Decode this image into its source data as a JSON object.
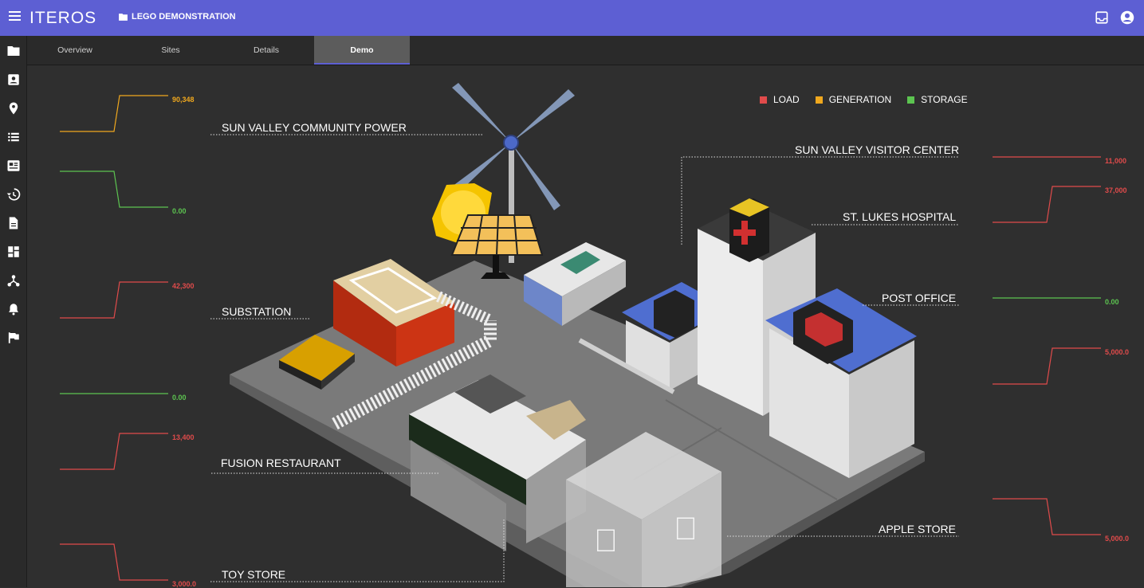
{
  "app": {
    "brand": "ITEROS",
    "project": "LEGO DEMONSTRATION"
  },
  "tabs": [
    {
      "label": "Overview"
    },
    {
      "label": "Sites"
    },
    {
      "label": "Details"
    },
    {
      "label": "Demo",
      "active": true
    }
  ],
  "sidebar": [
    "folder-icon",
    "contact-icon",
    "location-icon",
    "list-icon",
    "news-icon",
    "history-icon",
    "document-icon",
    "dashboard-icon",
    "network-icon",
    "bell-icon",
    "flag-icon"
  ],
  "legend": [
    {
      "label": "LOAD",
      "color": "#e04b4b"
    },
    {
      "label": "GENERATION",
      "color": "#f0a81e"
    },
    {
      "label": "STORAGE",
      "color": "#5cc450"
    }
  ],
  "sites": {
    "community_power": "SUN VALLEY COMMUNITY POWER",
    "substation": "SUBSTATION",
    "fusion": "FUSION RESTAURANT",
    "toy_store": "TOY STORE",
    "visitor_center": "SUN VALLEY VISITOR CENTER",
    "hospital": "ST. LUKES HOSPITAL",
    "post_office": "POST OFFICE",
    "apple_store": "APPLE STORE"
  },
  "sparks": {
    "left": [
      {
        "value": "90,348",
        "color": "#f0a81e",
        "type": "step-up"
      },
      {
        "value": "0.00",
        "color": "#5cc450",
        "type": "step-down"
      },
      {
        "value": "42,300",
        "color": "#e04b4b",
        "type": "step-up"
      },
      {
        "value": "0.00",
        "color": "#5cc450",
        "type": "flat"
      },
      {
        "value": "13,400",
        "color": "#e04b4b",
        "type": "step-up"
      },
      {
        "value": "3,000.0",
        "color": "#e04b4b",
        "type": "step-down"
      }
    ],
    "right": [
      {
        "value": "11,000",
        "color": "#e04b4b",
        "type": "flat"
      },
      {
        "value": "37,000",
        "color": "#e04b4b",
        "type": "step-up"
      },
      {
        "value": "0.00",
        "color": "#5cc450",
        "type": "flat"
      },
      {
        "value": "5,000.0",
        "color": "#e04b4b",
        "type": "step-up"
      },
      {
        "value": "5,000.0",
        "color": "#e04b4b",
        "type": "step-down"
      }
    ]
  }
}
